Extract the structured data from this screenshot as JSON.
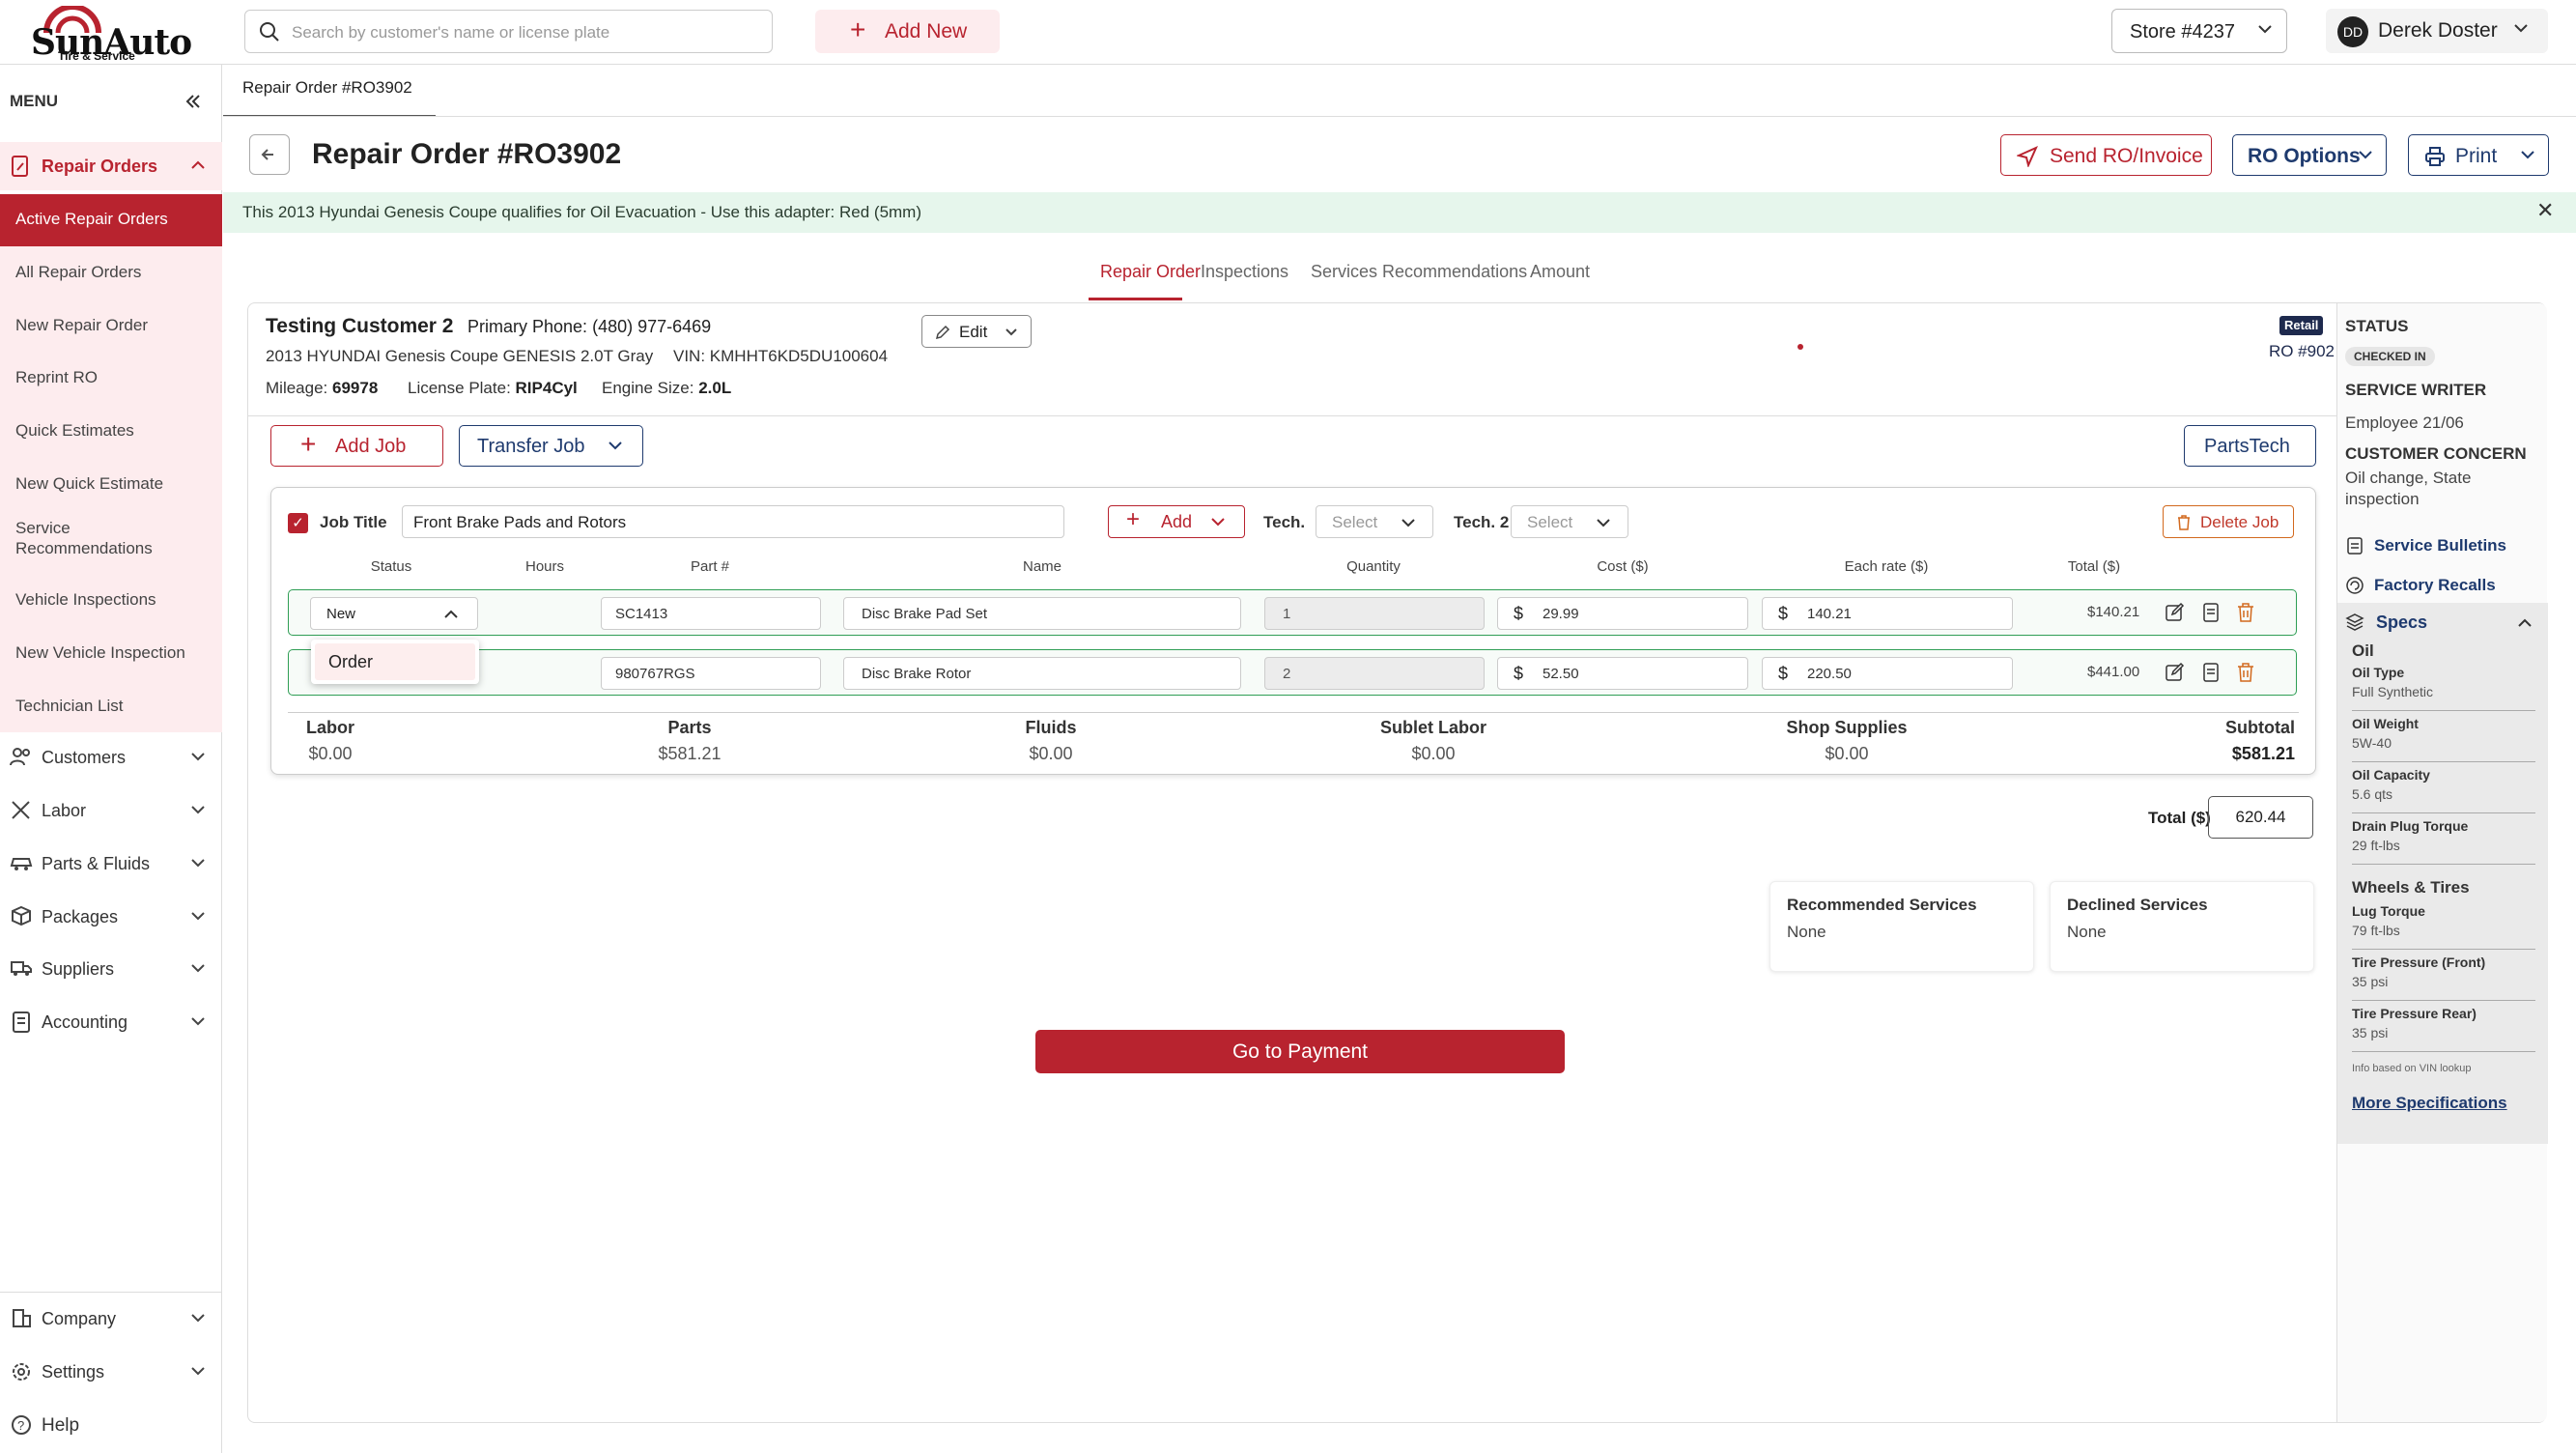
{
  "brand": {
    "name": "SunAuto",
    "tagline": "Tire & Service"
  },
  "topbar": {
    "search_placeholder": "Search by customer's name or license plate",
    "add_new": "Add New",
    "store": "Store #4237",
    "user_initials": "DD",
    "user_name": "Derek Doster"
  },
  "sidebar": {
    "menu_label": "MENU",
    "repair_orders": "Repair Orders",
    "items": [
      "Active Repair Orders",
      "All Repair Orders",
      "New Repair Order",
      "Reprint RO",
      "Quick Estimates",
      "New Quick Estimate",
      "Service Recommendations",
      "Vehicle Inspections",
      "New Vehicle Inspection",
      "Technician List"
    ],
    "groups": [
      "Customers",
      "Labor",
      "Parts & Fluids",
      "Packages",
      "Suppliers",
      "Accounting"
    ],
    "bottom": [
      "Company",
      "Settings",
      "Help"
    ]
  },
  "breadcrumb": "Repair Order #RO3902",
  "header": {
    "title": "Repair Order #RO3902",
    "send": "Send RO/Invoice",
    "options": "RO Options",
    "print": "Print"
  },
  "alert": "This 2013 Hyundai Genesis Coupe qualifies for Oil Evacuation - Use this adapter: Red (5mm)",
  "tabs": [
    "Repair Order",
    "Inspections",
    "Services Recommendations",
    "Amount"
  ],
  "customer": {
    "name": "Testing Customer 2",
    "phone_label": "Primary Phone:",
    "phone": "(480) 977-6469",
    "vehicle": "2013 HYUNDAI Genesis Coupe GENESIS 2.0T Gray",
    "vin_label": "VIN:",
    "vin": "KMHHT6KD5DU100604",
    "mileage_label": "Mileage:",
    "mileage": "69978",
    "plate_label": "License Plate:",
    "plate": "RIP4Cyl",
    "engine_label": "Engine Size:",
    "engine": "2.0L",
    "edit": "Edit",
    "type": "Retail",
    "ro_number": "RO #902"
  },
  "actions": {
    "add_job": "Add Job",
    "transfer_job": "Transfer Job",
    "partstech": "PartsTech"
  },
  "job": {
    "title_label": "Job Title",
    "title": "Front Brake Pads and Rotors",
    "add": "Add",
    "tech_label": "Tech.",
    "tech2_label": "Tech. 2",
    "select": "Select",
    "delete": "Delete Job",
    "columns": [
      "Status",
      "Hours",
      "Part #",
      "Name",
      "Quantity",
      "Cost ($)",
      "Each rate ($)",
      "Total ($)"
    ],
    "rows": [
      {
        "status": "New",
        "part": "SC1413",
        "name": "Disc Brake Pad Set",
        "qty": "1",
        "cost": "29.99",
        "rate": "140.21",
        "total": "$140.21"
      },
      {
        "status": "",
        "part": "980767RGS",
        "name": "Disc Brake Rotor",
        "qty": "2",
        "cost": "52.50",
        "rate": "220.50",
        "total": "$441.00"
      }
    ],
    "currency": "$",
    "status_option": "Order",
    "summary": {
      "labor": {
        "label": "Labor",
        "value": "$0.00"
      },
      "parts": {
        "label": "Parts",
        "value": "$581.21"
      },
      "fluids": {
        "label": "Fluids",
        "value": "$0.00"
      },
      "sublet": {
        "label": "Sublet Labor",
        "value": "$0.00"
      },
      "supplies": {
        "label": "Shop Supplies",
        "value": "$0.00"
      },
      "subtotal": {
        "label": "Subtotal",
        "value": "$581.21"
      }
    }
  },
  "totals": {
    "label": "Total ($)",
    "value": "620.44"
  },
  "services": {
    "recommended_label": "Recommended Services",
    "recommended": "None",
    "declined_label": "Declined Services",
    "declined": "None"
  },
  "payment": "Go to Payment",
  "panel": {
    "status_label": "STATUS",
    "status": "CHECKED IN",
    "writer_label": "SERVICE WRITER",
    "writer": "Employee 21/06",
    "concern_label": "CUSTOMER CONCERN",
    "concern": "Oil change, State inspection",
    "bulletins": "Service Bulletins",
    "recalls": "Factory Recalls",
    "specs_label": "Specs",
    "oil_label": "Oil",
    "oil": [
      {
        "k": "Oil Type",
        "v": "Full Synthetic"
      },
      {
        "k": "Oil Weight",
        "v": "5W-40"
      },
      {
        "k": "Oil Capacity",
        "v": "5.6 qts"
      },
      {
        "k": "Drain Plug Torque",
        "v": "29 ft-lbs"
      }
    ],
    "wheels_label": "Wheels & Tires",
    "wheels": [
      {
        "k": "Lug Torque",
        "v": "79 ft-lbs"
      },
      {
        "k": "Tire Pressure (Front)",
        "v": "35 psi"
      },
      {
        "k": "Tire Pressure Rear)",
        "v": "35 psi"
      }
    ],
    "note": "Info based on VIN lookup",
    "more": "More Specifications"
  },
  "colors": {
    "brand_red": "#b8232f",
    "success_green": "#2f9e55",
    "navy": "#1e3a6e"
  }
}
